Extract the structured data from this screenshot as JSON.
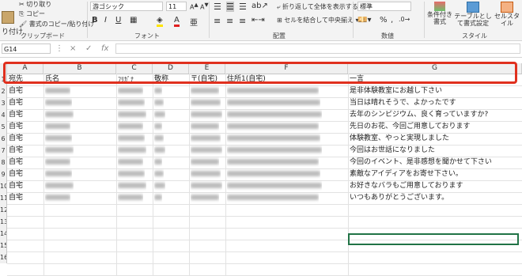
{
  "ribbon": {
    "clipboard": {
      "cut": "切り取り",
      "copy": "コピー",
      "format_painter": "書式のコピー/貼り付け",
      "paste": "り付け",
      "group": "クリップボード"
    },
    "font": {
      "name": "游ゴシック",
      "size": "11",
      "bold": "B",
      "italic": "I",
      "underline": "U",
      "font_color_letter": "A",
      "ruby": "亜",
      "group": "フォント"
    },
    "alignment": {
      "wrap": "折り返して全体を表示する",
      "merge": "セルを結合して中央揃え",
      "group": "配置"
    },
    "number": {
      "format": "標準",
      "percent": "%",
      "comma": ",",
      "group": "数値"
    },
    "styles": {
      "conditional": "条件付き書式",
      "table": "テーブルとして書式設定",
      "cell": "セルスタイル",
      "group": "スタイル"
    }
  },
  "formula_bar": {
    "name_box": "G14",
    "cancel": "×",
    "enter": "✓",
    "fx": "fx",
    "value": ""
  },
  "columns": [
    "A",
    "B",
    "C",
    "D",
    "E",
    "F",
    "G"
  ],
  "row_numbers": [
    "1",
    "2",
    "3",
    "4",
    "5",
    "6",
    "7",
    "8",
    "9",
    "10",
    "11",
    "12",
    "13",
    "14",
    "15",
    "16"
  ],
  "header_row": [
    "宛先",
    "氏名",
    "ﾌﾘｶﾞﾅ",
    "敬称",
    "〒(自宅)",
    "住所1(自宅)",
    "一言"
  ],
  "records": [
    {
      "a": "自宅",
      "g": "是非体験教室にお越し下さい"
    },
    {
      "a": "自宅",
      "g": "当日は晴れそうで、よかったです"
    },
    {
      "a": "自宅",
      "g": "去年のシンピジウム、良く育っていますか?"
    },
    {
      "a": "自宅",
      "g": "先日のお花、今回ご用意しております"
    },
    {
      "a": "自宅",
      "g": "体験教室、やっと実現しました"
    },
    {
      "a": "自宅",
      "g": "今回はお世話になりました"
    },
    {
      "a": "自宅",
      "g": "今回のイベント、是非感想を聞かせて下さい"
    },
    {
      "a": "自宅",
      "g": "素敵なアイディアをお寄せ下さい。"
    },
    {
      "a": "自宅",
      "g": "お好きなバラもご用意しております"
    },
    {
      "a": "自宅",
      "g": "いつもありがとうございます。"
    }
  ]
}
